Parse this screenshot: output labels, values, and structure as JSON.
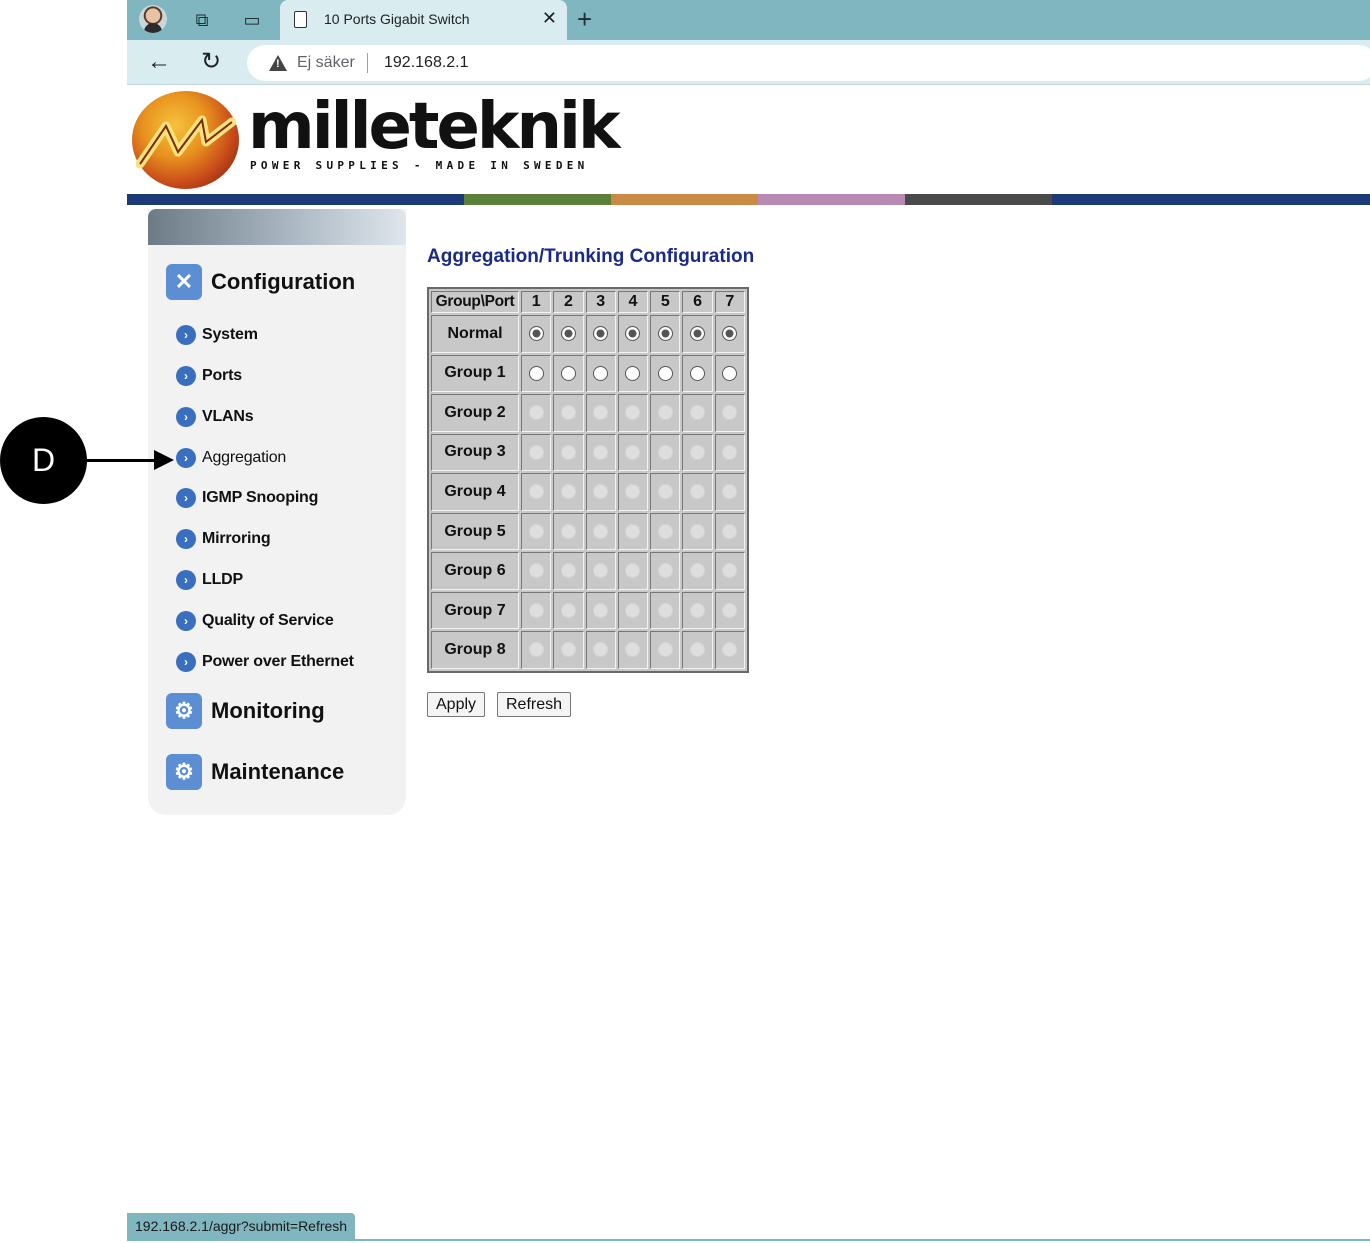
{
  "browser": {
    "tab_title": "10 Ports Gigabit Switch",
    "security_label": "Ej säker",
    "url": "192.168.2.1",
    "status_url": "192.168.2.1/aggr?submit=Refresh"
  },
  "logo": {
    "brand": "milleteknik",
    "tagline": "POWER SUPPLIES - MADE IN SWEDEN"
  },
  "colors": {
    "accent_title": "#1a2a8a",
    "browser_chrome": "#7fb6bf",
    "bar_segments": [
      "#1d3a78",
      "#5c7f3a",
      "#c98a45",
      "#b889b3",
      "#4a4a4a",
      "#1d3a78"
    ]
  },
  "sidebar": {
    "configuration": {
      "label": "Configuration",
      "icon": "tools-icon",
      "items": [
        {
          "label": "System"
        },
        {
          "label": "Ports"
        },
        {
          "label": "VLANs"
        },
        {
          "label": "Aggregation"
        },
        {
          "label": "IGMP Snooping"
        },
        {
          "label": "Mirroring"
        },
        {
          "label": "LLDP"
        },
        {
          "label": "Quality of Service"
        },
        {
          "label": "Power over Ethernet"
        }
      ]
    },
    "monitoring": {
      "label": "Monitoring",
      "icon": "monitor-tools-icon"
    },
    "maintenance": {
      "label": "Maintenance",
      "icon": "maintenance-tools-icon"
    }
  },
  "annotation": {
    "letter": "D"
  },
  "main": {
    "title": "Aggregation/Trunking Configuration",
    "grid": {
      "corner_label": "Group\\Port",
      "ports": [
        "1",
        "2",
        "3",
        "4",
        "5",
        "6",
        "7"
      ],
      "rows": [
        {
          "label": "Normal",
          "state": "checked"
        },
        {
          "label": "Group 1",
          "state": "empty"
        },
        {
          "label": "Group 2",
          "state": "disabled"
        },
        {
          "label": "Group 3",
          "state": "disabled"
        },
        {
          "label": "Group 4",
          "state": "disabled"
        },
        {
          "label": "Group 5",
          "state": "disabled"
        },
        {
          "label": "Group 6",
          "state": "disabled"
        },
        {
          "label": "Group 7",
          "state": "disabled"
        },
        {
          "label": "Group 8",
          "state": "disabled"
        }
      ]
    },
    "buttons": {
      "apply": "Apply",
      "refresh": "Refresh"
    }
  }
}
